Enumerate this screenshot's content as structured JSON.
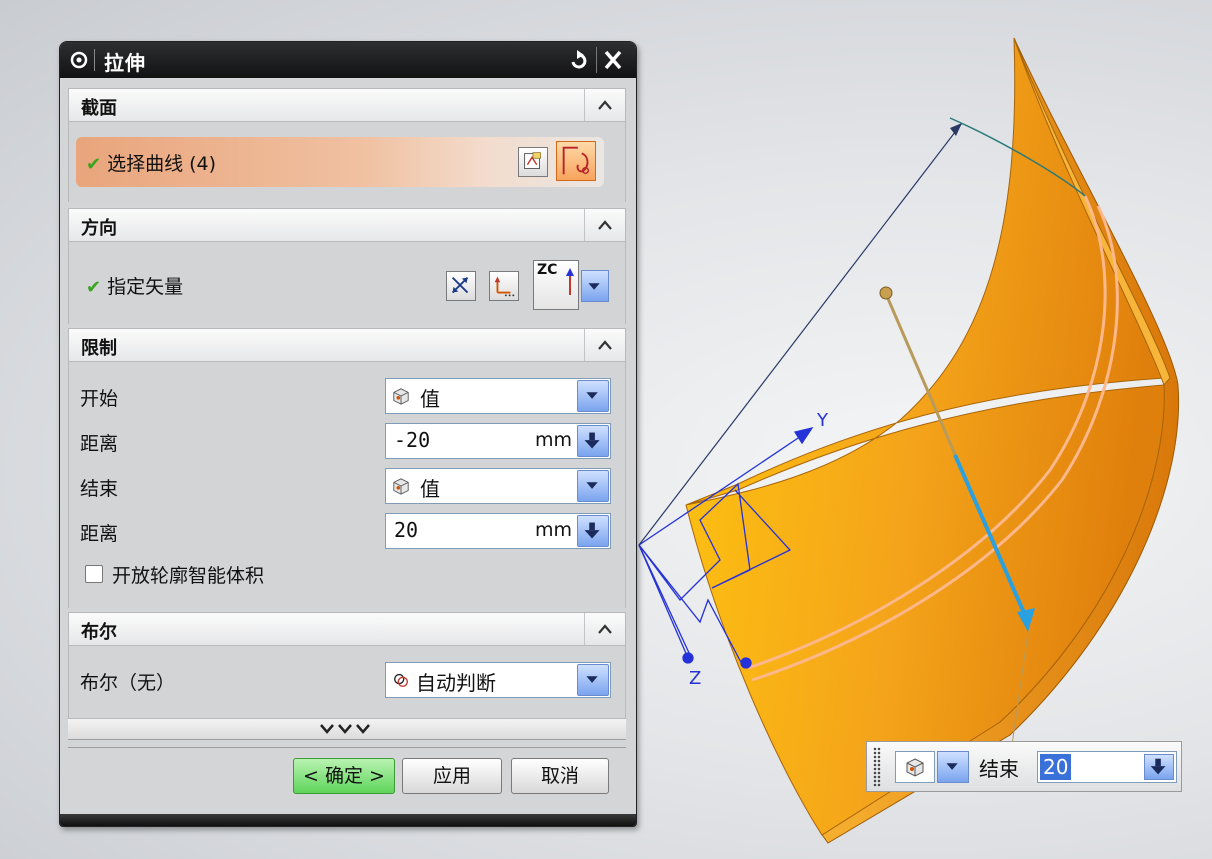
{
  "dialog": {
    "title": "拉伸",
    "sections": {
      "section": {
        "header": "截面",
        "select_curve": "选择曲线 (4)"
      },
      "direction": {
        "header": "方向",
        "specify_vector": "指定矢量",
        "vector_value": "ZC"
      },
      "limits": {
        "header": "限制",
        "start_label": "开始",
        "start_value": "值",
        "start_distance_label": "距离",
        "start_distance": "-20",
        "end_label": "结束",
        "end_value": "值",
        "end_distance_label": "距离",
        "end_distance": "20",
        "unit": "mm",
        "open_profile_label": "开放轮廓智能体积"
      },
      "boolean": {
        "header": "布尔",
        "label": "布尔（无）",
        "value": "自动判断"
      }
    },
    "buttons": {
      "ok": "< 确定 >",
      "apply": "应用",
      "cancel": "取消"
    }
  },
  "viewport": {
    "axis_y": "Y",
    "axis_z": "Z",
    "float_toolbar": {
      "label": "结束",
      "value": "20"
    }
  },
  "colors": {
    "surface": "#f0a018",
    "ok_button": "#5ed45a",
    "accent_blue": "#3a71d8",
    "checkmark": "#3aa41f"
  }
}
